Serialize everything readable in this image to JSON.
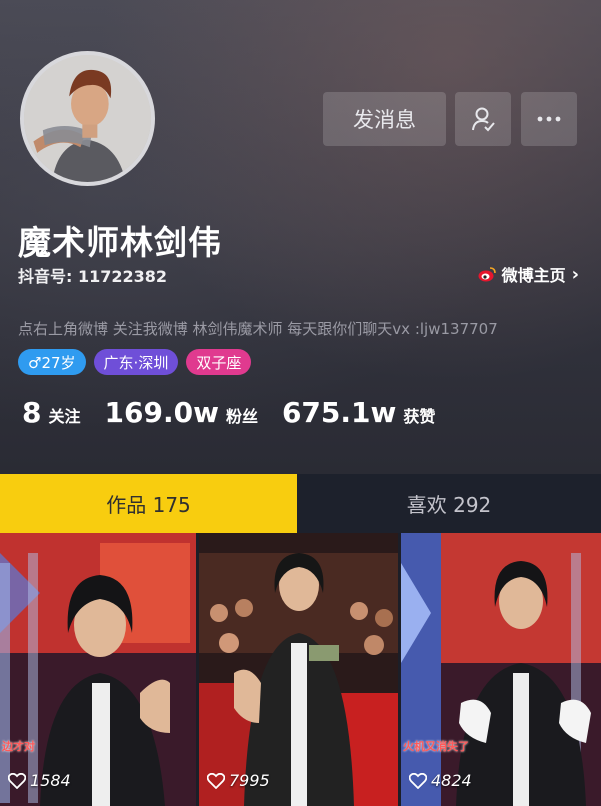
{
  "profile": {
    "name": "魔术师林剑伟",
    "douyin_id": "抖音号: 11722382",
    "weibo_link": "微博主页",
    "bio": "点右上角微博 关注我微博 林剑伟魔术师 每天跟你们聊天vx :ljw137707"
  },
  "actions": {
    "message_label": "发消息",
    "follow_icon": "follow-user-icon",
    "more_icon": "more-icon"
  },
  "tags": {
    "age": "♂27岁",
    "location": "广东·深圳",
    "sign": "双子座"
  },
  "stats": {
    "following_num": "8",
    "following_label": "关注",
    "fans_num": "169.0w",
    "fans_label": "粉丝",
    "likes_num": "675.1w",
    "likes_label": "获赞"
  },
  "tabs": {
    "works": "作品 175",
    "likes": "喜欢 292"
  },
  "videos": [
    {
      "likes": "1584",
      "caption": "边才对"
    },
    {
      "likes": "7995",
      "caption": ""
    },
    {
      "likes": "4824",
      "caption": "火机又消失了"
    }
  ],
  "colors": {
    "tab_active": "#f8cd0f",
    "tag_age": "#2f9bf0",
    "tag_location": "#6f4fd8",
    "tag_sign": "#e03a8f"
  }
}
